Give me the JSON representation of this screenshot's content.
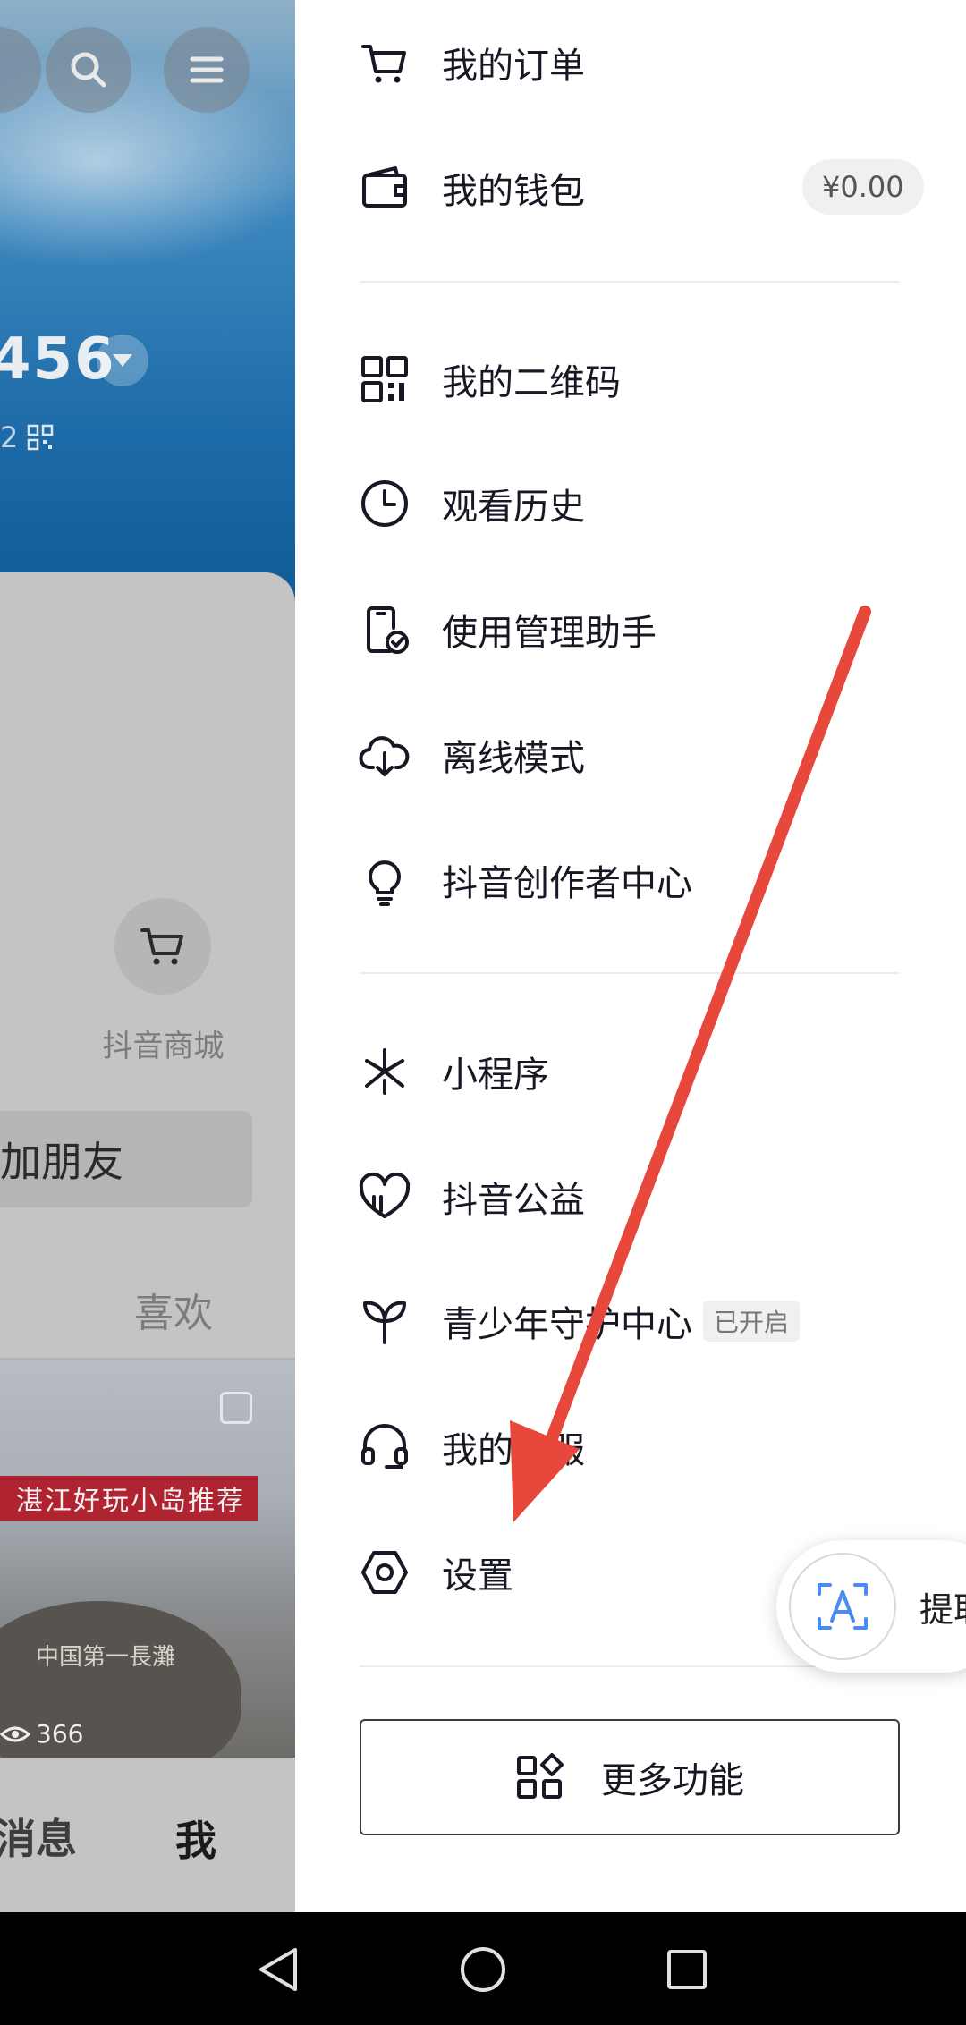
{
  "left_page": {
    "follower_number": "456",
    "id_suffix": "2",
    "shop_label": "抖音商城",
    "add_friend_label": "加朋友",
    "like_tab": "喜欢",
    "video_banner": "湛江好玩小岛推荐",
    "video_rock_text": "中国第一長灘",
    "video_views": "366",
    "nav_message": "消息",
    "nav_me": "我"
  },
  "drawer": {
    "menu": [
      {
        "label": "我的订单",
        "icon": "cart-icon"
      },
      {
        "label": "我的钱包",
        "icon": "wallet-icon",
        "badge": "¥0.00"
      },
      {
        "label": "我的二维码",
        "icon": "qr-code-icon"
      },
      {
        "label": "观看历史",
        "icon": "clock-icon"
      },
      {
        "label": "使用管理助手",
        "icon": "phone-check-icon"
      },
      {
        "label": "离线模式",
        "icon": "cloud-download-icon"
      },
      {
        "label": "抖音创作者中心",
        "icon": "lightbulb-icon"
      },
      {
        "label": "小程序",
        "icon": "mini-program-icon"
      },
      {
        "label": "抖音公益",
        "icon": "heart-icon"
      },
      {
        "label": "青少年守护中心",
        "icon": "sprout-icon",
        "badge": "已开启"
      },
      {
        "label": "我的客服",
        "icon": "headset-icon"
      },
      {
        "label": "设置",
        "icon": "settings-hexagon-icon"
      }
    ],
    "more_button": "更多功能"
  },
  "floating": {
    "text": "提取"
  },
  "colors": {
    "annotation_arrow": "#e8483b",
    "drawer_bg": "#ffffff",
    "text_primary": "#161823"
  }
}
